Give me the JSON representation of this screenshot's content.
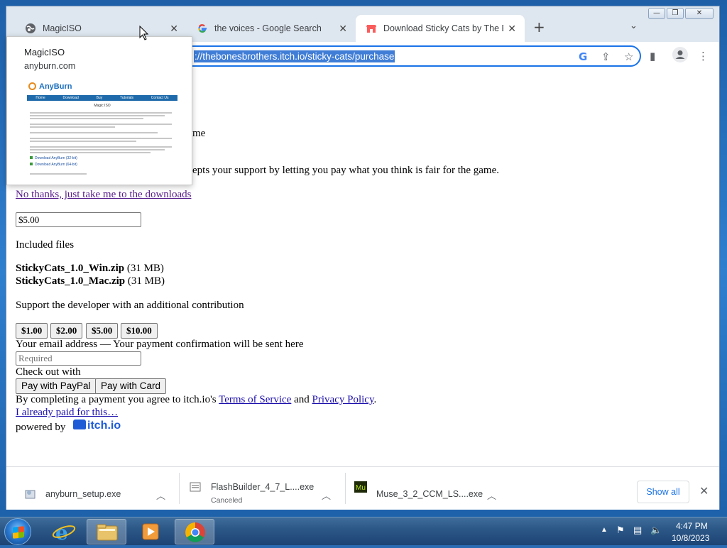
{
  "browser": {
    "tabs": [
      {
        "title": "MagicISO",
        "icon": "globe-icon"
      },
      {
        "title": "the voices - Google Search",
        "icon": "google-icon"
      },
      {
        "title": "Download Sticky Cats by The Bo",
        "icon": "itchio-icon"
      }
    ],
    "url": "://thebonesbrothers.itch.io/sticky-cats/purchase",
    "window_controls": {
      "minimize": "—",
      "restore": "❐",
      "close": "✕"
    }
  },
  "hovercard": {
    "title": "MagicISO",
    "domain": "anyburn.com",
    "preview": {
      "logo": "AnyBurn",
      "nav": [
        "Home",
        "Download",
        "Buy",
        "Tutorials",
        "Contact Us"
      ],
      "heading": "Magic ISO",
      "links": [
        "Download AnyBurn (32-bit)",
        "Download AnyBurn (64-bit)"
      ]
    }
  },
  "page": {
    "partial_name": "me",
    "intro_partial": "epts your support by letting you pay what you think is fair for the game.",
    "no_thanks_link": "No thanks, just take me to the downloads",
    "price_value": "$5.00",
    "included_files_label": "Included files",
    "files": [
      {
        "name": "StickyCats_1.0_Win.zip",
        "size": "(31 MB)"
      },
      {
        "name": "StickyCats_1.0_Mac.zip",
        "size": "(31 MB)"
      }
    ],
    "support_label": "Support the developer with an additional contribution",
    "amounts": [
      "$1.00",
      "$2.00",
      "$5.00",
      "$10.00"
    ],
    "email_label": "Your email address — Your payment confirmation will be sent here",
    "email_placeholder": "Required",
    "checkout_label": "Check out with",
    "paypal_button": "Pay with PayPal",
    "card_button": "Pay with Card",
    "agree_prefix": "By completing a payment you agree to itch.io's",
    "terms_link": "Terms of Service",
    "and_text": "and",
    "privacy_link": "Privacy Policy",
    "period": ".",
    "already_paid_link": "I already paid for this…",
    "powered_by": "powered by",
    "itch_logo_text": "itch.io"
  },
  "downloads": {
    "items": [
      {
        "name": "anyburn_setup.exe",
        "status": ""
      },
      {
        "name": "FlashBuilder_4_7_L....exe",
        "status": "Canceled"
      },
      {
        "name": "Muse_3_2_CCM_LS....exe",
        "status": ""
      }
    ],
    "show_all": "Show all"
  },
  "taskbar": {
    "time": "4:47 PM",
    "date": "10/8/2023"
  }
}
